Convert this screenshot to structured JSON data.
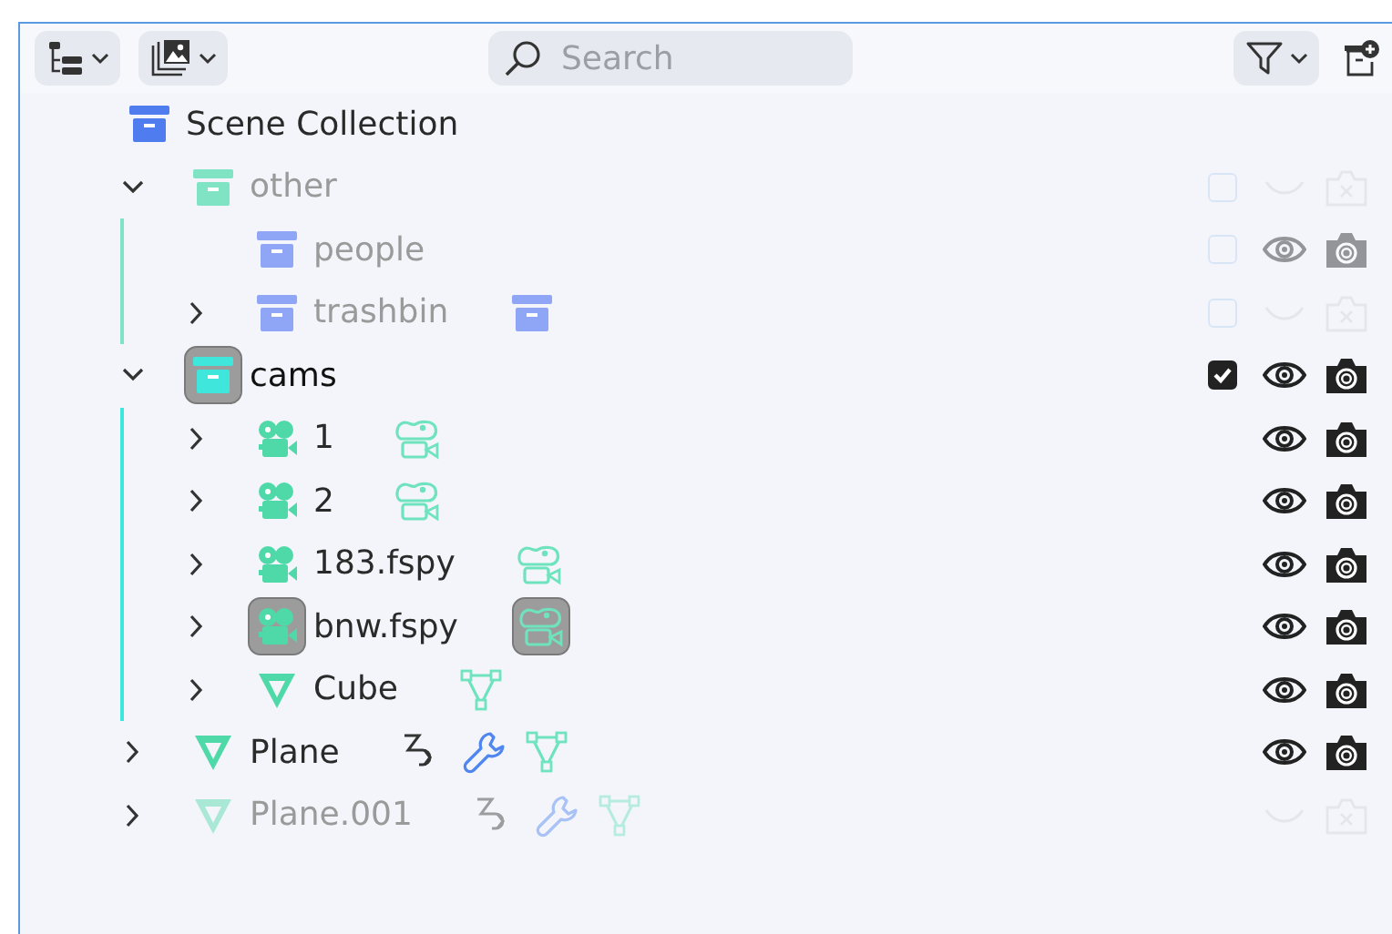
{
  "toolbar": {
    "search": {
      "placeholder": "Search"
    }
  },
  "tree": [
    {
      "name": "Scene Collection",
      "kind": "collection",
      "color": "#4f7df0",
      "dimmed": false,
      "active": false,
      "children": [
        {
          "name": "other",
          "kind": "collection",
          "color": "#7fe3c4",
          "dimmed": true,
          "active": false,
          "expanded": true,
          "included": false,
          "visible": false,
          "renderable": false,
          "children": [
            {
              "name": "people",
              "kind": "collection",
              "color": "#8ea6f5",
              "dimmed": true,
              "active": false,
              "included": false,
              "visible": true,
              "renderable": true
            },
            {
              "name": "trashbin",
              "kind": "collection",
              "color": "#8ea6f5",
              "dimmed": true,
              "active": false,
              "expanded": false,
              "included": false,
              "visible": false,
              "renderable": false,
              "extras": [
                {
                  "kind": "collection"
                }
              ]
            }
          ]
        },
        {
          "name": "cams",
          "kind": "collection",
          "color": "#3fe6dc",
          "dimmed": false,
          "active": true,
          "expanded": true,
          "included": true,
          "visible": true,
          "renderable": true,
          "children": [
            {
              "name": "1",
              "kind": "camera",
              "dimmed": false,
              "active": false,
              "expanded": false,
              "visible": true,
              "renderable": true,
              "extras": [
                {
                  "kind": "camera-data"
                }
              ]
            },
            {
              "name": "2",
              "kind": "camera",
              "dimmed": false,
              "active": false,
              "expanded": false,
              "visible": true,
              "renderable": true,
              "extras": [
                {
                  "kind": "camera-data"
                }
              ]
            },
            {
              "name": "183.fspy",
              "kind": "camera",
              "dimmed": false,
              "active": false,
              "expanded": false,
              "visible": true,
              "renderable": true,
              "extras": [
                {
                  "kind": "camera-data"
                }
              ]
            },
            {
              "name": "bnw.fspy",
              "kind": "camera",
              "dimmed": false,
              "active": true,
              "expanded": false,
              "visible": true,
              "renderable": true,
              "extras": [
                {
                  "kind": "camera-data"
                }
              ]
            },
            {
              "name": "Cube",
              "kind": "mesh",
              "dimmed": false,
              "active": false,
              "expanded": false,
              "visible": true,
              "renderable": true,
              "extras": [
                {
                  "kind": "mesh-data"
                }
              ]
            }
          ]
        },
        {
          "name": "Plane",
          "kind": "mesh",
          "dimmed": false,
          "active": false,
          "expanded": false,
          "visible": true,
          "renderable": true,
          "extras": [
            {
              "kind": "modifier"
            },
            {
              "kind": "wrench"
            },
            {
              "kind": "mesh-data"
            }
          ]
        },
        {
          "name": "Plane.001",
          "kind": "mesh",
          "dimmed": true,
          "active": false,
          "expanded": false,
          "visible": false,
          "renderable": false,
          "extras": [
            {
              "kind": "modifier"
            },
            {
              "kind": "wrench"
            },
            {
              "kind": "mesh-data"
            }
          ]
        }
      ]
    }
  ]
}
